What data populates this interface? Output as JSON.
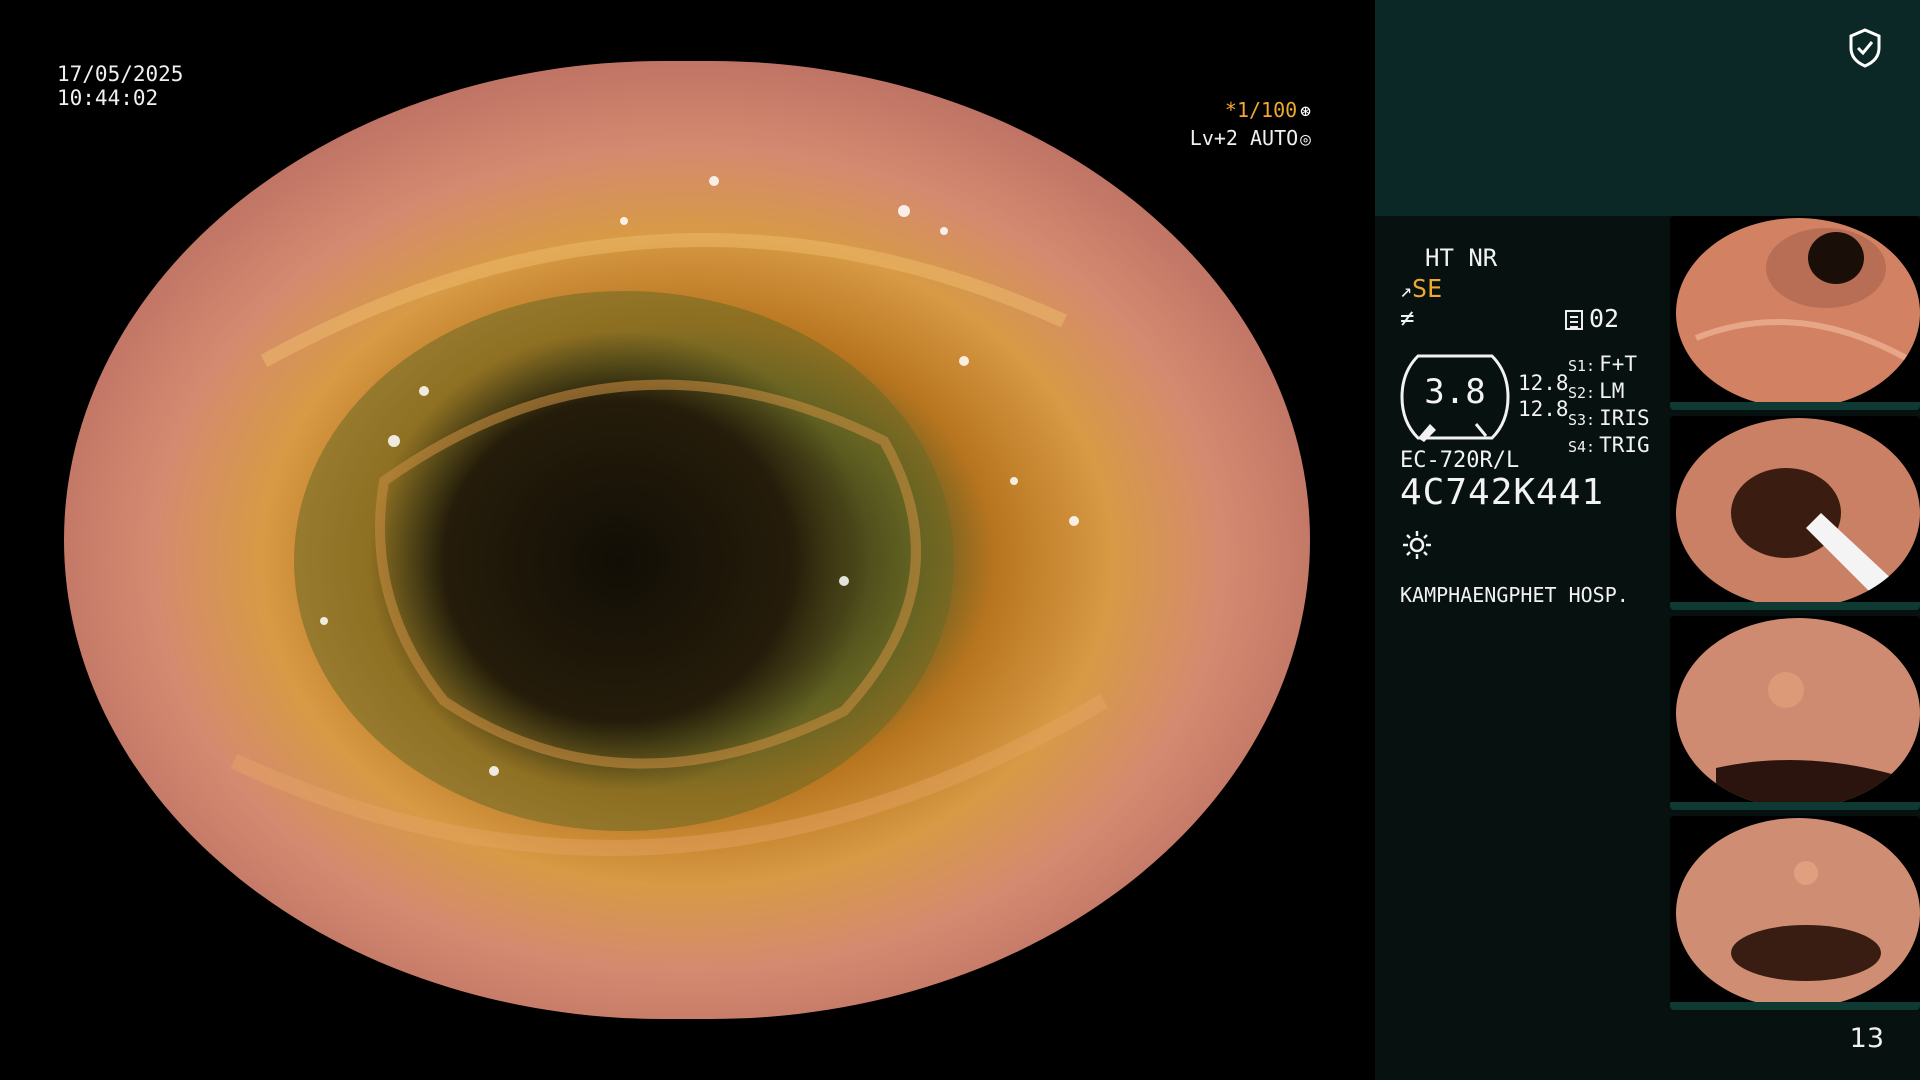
{
  "main": {
    "date": "17/05/2025",
    "time": "10:44:02",
    "shutter": "*1/100",
    "iris": "Lv+2 AUTO"
  },
  "panel": {
    "mode": "HT NR",
    "se_label": "SE",
    "f_label": "≠",
    "frame_no": "02",
    "dial_value": "3.8",
    "val1": "12.8",
    "val2": "12.8",
    "scopes": [
      {
        "key": "S1:",
        "val": "F+T"
      },
      {
        "key": "S2:",
        "val": "LM"
      },
      {
        "key": "S3:",
        "val": "IRIS"
      },
      {
        "key": "S4:",
        "val": "TRIG"
      }
    ],
    "model": "EC-720R/L",
    "serial": "4C742K441",
    "hospital": "KAMPHAENGPHET HOSP.",
    "page": "13"
  },
  "colors": {
    "accent": "#f0a830",
    "panel_bg": "#071210",
    "top_band": "#0b2826"
  }
}
